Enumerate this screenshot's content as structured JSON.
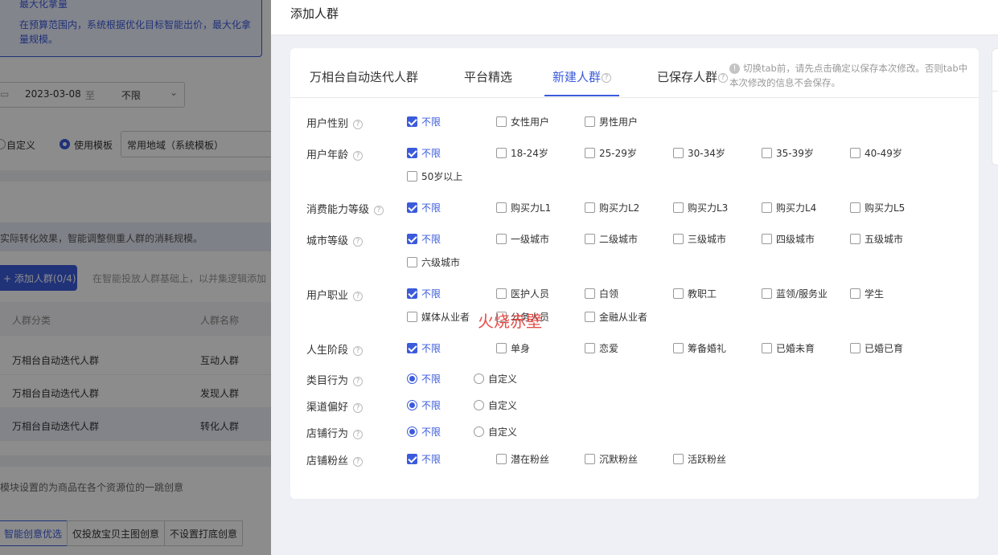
{
  "background": {
    "strategy": {
      "title": "最大化拿量",
      "desc": "在预算范围内，系统根据优化目标智能出价，最大化拿量规模。"
    },
    "date": {
      "start": "2023-03-08",
      "to": "至",
      "end": "不限"
    },
    "region": {
      "custom_label": "自定义",
      "template_label": "使用模板",
      "template_value": "常用地域（系统模板）"
    },
    "crowd_desc": "实际转化效果，智能调整侧重人群的消耗规模。",
    "add_crowd_button": "添加人群(0/4)",
    "add_crowd_hint": "在智能投放人群基础上，以并集逻辑添加",
    "table": {
      "headers": [
        "人群分类",
        "人群名称"
      ],
      "rows": [
        [
          "万相台自动迭代人群",
          "互动人群"
        ],
        [
          "万相台自动迭代人群",
          "发现人群"
        ],
        [
          "万相台自动迭代人群",
          "转化人群"
        ]
      ]
    },
    "creative_desc": "模块设置的为商品在各个资源位的一跳创意",
    "creative_tabs": [
      "智能创意优选",
      "仅投放宝贝主图创意",
      "不设置打底创意"
    ]
  },
  "drawer": {
    "title": "添加人群",
    "tabs": [
      {
        "label": "万相台自动迭代人群",
        "help": false
      },
      {
        "label": "平台精选",
        "help": false
      },
      {
        "label": "新建人群",
        "help": true
      },
      {
        "label": "已保存人群",
        "help": true
      }
    ],
    "active_tab": "新建人群",
    "notice": "切换tab前，请先点击确定以保存本次修改。否则tab中本次修改的信息不会保存。",
    "watermark": "火烧赤壁",
    "rows": [
      {
        "label": "用户性别",
        "type": "checkbox",
        "options": [
          {
            "text": "不限",
            "checked": true
          },
          {
            "text": "女性用户"
          },
          {
            "text": "男性用户"
          }
        ]
      },
      {
        "label": "用户年龄",
        "type": "checkbox",
        "options": [
          {
            "text": "不限",
            "checked": true
          },
          {
            "text": "18-24岁"
          },
          {
            "text": "25-29岁"
          },
          {
            "text": "30-34岁"
          },
          {
            "text": "35-39岁"
          },
          {
            "text": "40-49岁"
          },
          {
            "text": "50岁以上"
          }
        ]
      },
      {
        "label": "消费能力等级",
        "type": "checkbox",
        "options": [
          {
            "text": "不限",
            "checked": true
          },
          {
            "text": "购买力L1"
          },
          {
            "text": "购买力L2"
          },
          {
            "text": "购买力L3"
          },
          {
            "text": "购买力L4"
          },
          {
            "text": "购买力L5"
          }
        ]
      },
      {
        "label": "城市等级",
        "type": "checkbox",
        "options": [
          {
            "text": "不限",
            "checked": true
          },
          {
            "text": "一级城市"
          },
          {
            "text": "二级城市"
          },
          {
            "text": "三级城市"
          },
          {
            "text": "四级城市"
          },
          {
            "text": "五级城市"
          },
          {
            "text": "六级城市"
          }
        ]
      },
      {
        "label": "用户职业",
        "type": "checkbox",
        "options": [
          {
            "text": "不限",
            "checked": true
          },
          {
            "text": "医护人员"
          },
          {
            "text": "白领"
          },
          {
            "text": "教职工"
          },
          {
            "text": "蓝领/服务业"
          },
          {
            "text": "学生"
          },
          {
            "text": "媒体从业者"
          },
          {
            "text": "公务人员"
          },
          {
            "text": "金融从业者"
          }
        ]
      },
      {
        "label": "人生阶段",
        "type": "checkbox",
        "options": [
          {
            "text": "不限",
            "checked": true
          },
          {
            "text": "单身"
          },
          {
            "text": "恋爱"
          },
          {
            "text": "筹备婚礼"
          },
          {
            "text": "已婚未育"
          },
          {
            "text": "已婚已育"
          }
        ]
      },
      {
        "label": "类目行为",
        "type": "radio",
        "options": [
          {
            "text": "不限",
            "checked": true
          },
          {
            "text": "自定义"
          }
        ]
      },
      {
        "label": "渠道偏好",
        "type": "radio",
        "options": [
          {
            "text": "不限",
            "checked": true
          },
          {
            "text": "自定义"
          }
        ]
      },
      {
        "label": "店铺行为",
        "type": "radio",
        "options": [
          {
            "text": "不限",
            "checked": true
          },
          {
            "text": "自定义"
          }
        ]
      },
      {
        "label": "店铺粉丝",
        "type": "checkbox",
        "options": [
          {
            "text": "不限",
            "checked": true
          },
          {
            "text": "潜在粉丝"
          },
          {
            "text": "沉默粉丝"
          },
          {
            "text": "活跃粉丝"
          }
        ]
      }
    ]
  }
}
